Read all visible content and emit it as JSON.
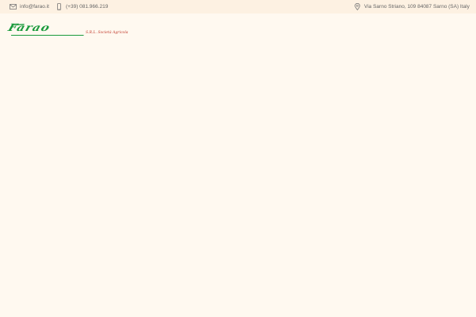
{
  "topbar": {
    "email": "info@farao.it",
    "phone": "(+39) 081.966.219",
    "address": "Via Sarno Striano, 109 84087 Sarno (SA) Italy"
  },
  "logo": {
    "wordmark": "Farao",
    "tagline": "S.R.L. Società Agricola"
  },
  "icons": {
    "email": "envelope-icon",
    "phone": "smartphone-icon",
    "address": "map-pin-icon"
  },
  "colors": {
    "page_background": "#fff9f0",
    "topbar_background": "#fdf1e2",
    "brand_green": "#1a9a3c",
    "brand_red": "#c0392b",
    "text": "#666666"
  }
}
